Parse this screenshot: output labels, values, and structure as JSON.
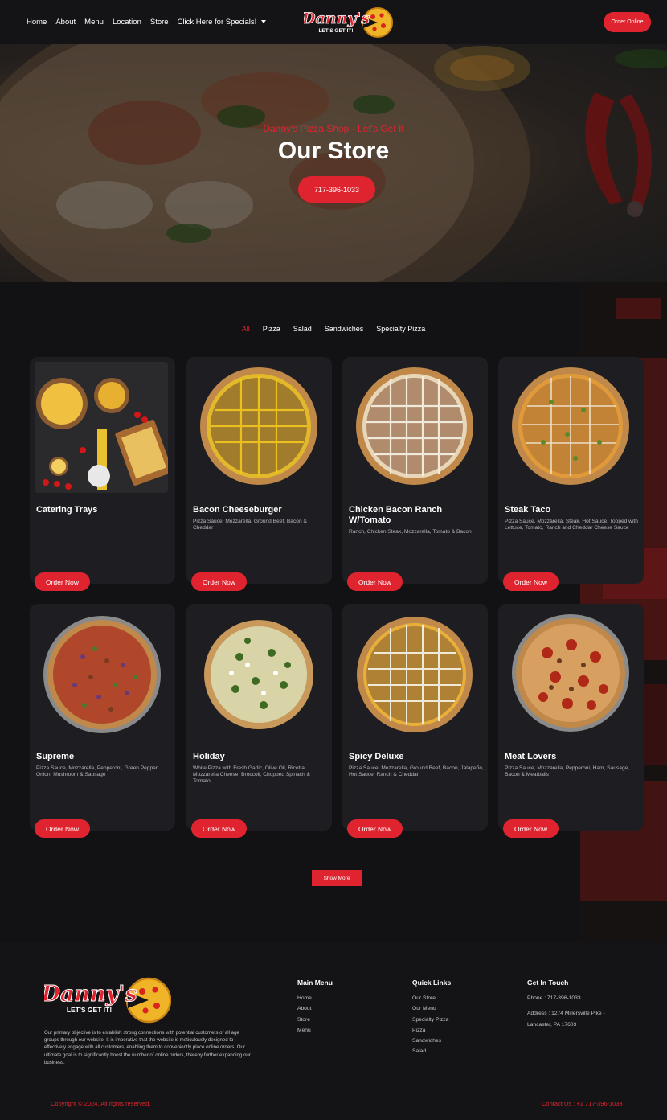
{
  "header": {
    "nav": [
      {
        "label": "Home"
      },
      {
        "label": "About"
      },
      {
        "label": "Menu"
      },
      {
        "label": "Location"
      },
      {
        "label": "Store"
      },
      {
        "label": "Click Here for Specials!"
      }
    ],
    "logo_text": "Danny's",
    "logo_tagline": "LET'S GET IT!",
    "order_online": "Order Online"
  },
  "hero": {
    "subtitle": "Danny's Pizza Shop - Let's Get It",
    "title": "Our Store",
    "phone_button": "717-396-1033"
  },
  "filters": [
    "All",
    "Pizza",
    "Salad",
    "Sandwiches",
    "Specialty Pizza"
  ],
  "products": [
    {
      "name": "Catering Trays",
      "desc": "",
      "button": "Order Now",
      "image": "catering-trays-image"
    },
    {
      "name": "Bacon Cheeseburger",
      "desc": "Pizza Sauce, Mozzarella, Ground Beef, Bacon & Cheddar",
      "button": "Order Now",
      "image": "pizza-image"
    },
    {
      "name": "Chicken Bacon Ranch W/Tomato",
      "desc": "Ranch, Chicken Steak, Mozzarella, Tomato & Bacon",
      "button": "Order Now",
      "image": "pizza-image"
    },
    {
      "name": "Steak Taco",
      "desc": "Pizza Sauce, Mozzarella, Steak, Hot Sauce, Topped with Lettuce, Tomato, Ranch and Cheddar Cheese Sauce",
      "button": "Order Now",
      "image": "pizza-image"
    },
    {
      "name": "Supreme",
      "desc": "Pizza Sauce, Mozzarella, Pepperoni, Green Pepper, Onion, Mushroom & Sausage",
      "button": "Order Now",
      "image": "pizza-image"
    },
    {
      "name": "Holiday",
      "desc": "White Pizza with Fresh Garlic, Olive Oil, Ricotta, Mozzarella Cheese, Broccoli, Chopped Spinach & Tomato",
      "button": "Order Now",
      "image": "pizza-image"
    },
    {
      "name": "Spicy Deluxe",
      "desc": "Pizza Sauce, Mozzarella, Ground Beef, Bacon, Jalapeño, Hot Sauce, Ranch & Cheddar",
      "button": "Order Now",
      "image": "pizza-image"
    },
    {
      "name": "Meat Lovers",
      "desc": "Pizza Sauce, Mozzarella, Pepperoni, Ham, Sausage, Bacon & Meatballs",
      "button": "Order Now",
      "image": "pizza-image"
    }
  ],
  "show_more": "Show More",
  "footer": {
    "about": "Our primary objective is to establish strong connections with potential customers of all age groups through our website. It is imperative that the website is meticulously designed to effectively engage with all customers, enabling them to conveniently place online orders. Our ultimate goal is to significantly boost the number of online orders, thereby further expanding our business.",
    "main_menu_title": "Main Menu",
    "main_menu": [
      "Home",
      "About",
      "Store",
      "Menu"
    ],
    "quick_links_title": "Quick Links",
    "quick_links": [
      "Our Store",
      "Our Menu",
      "Specialty Pizza",
      "Pizza",
      "Sandwiches",
      "Salad"
    ],
    "contact_title": "Get In Touch",
    "phone": "Phone : 717-396-1033",
    "address_line1": "Address : 1274 Millersville Pike -",
    "address_line2": "Lancaster, PA 17603",
    "copyright": "Copyright © 2024. All rights reserved.",
    "contact_us": "Contact Us : +1 717-396-1033"
  },
  "colors": {
    "accent": "#e0242f",
    "background": "#131316",
    "card": "#1e1e22"
  }
}
